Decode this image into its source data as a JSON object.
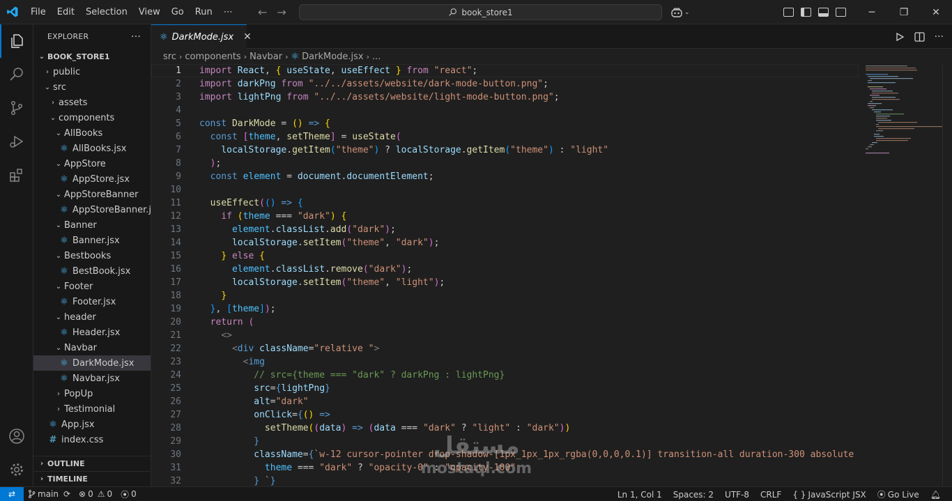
{
  "menu": [
    "File",
    "Edit",
    "Selection",
    "View",
    "Go",
    "Run",
    "⋯"
  ],
  "search": {
    "text": "book_store1"
  },
  "explorer": {
    "title": "EXPLORER",
    "more": "···",
    "root": "BOOK_STORE1",
    "tree": [
      {
        "label": "public",
        "type": "folder",
        "open": false,
        "depth": 0
      },
      {
        "label": "src",
        "type": "folder",
        "open": true,
        "depth": 0
      },
      {
        "label": "assets",
        "type": "folder",
        "open": false,
        "depth": 1
      },
      {
        "label": "components",
        "type": "folder",
        "open": true,
        "depth": 1
      },
      {
        "label": "AllBooks",
        "type": "folder",
        "open": true,
        "depth": 2
      },
      {
        "label": "AllBooks.jsx",
        "type": "jsx",
        "depth": 3
      },
      {
        "label": "AppStore",
        "type": "folder",
        "open": true,
        "depth": 2
      },
      {
        "label": "AppStore.jsx",
        "type": "jsx",
        "depth": 3
      },
      {
        "label": "AppStoreBanner",
        "type": "folder",
        "open": true,
        "depth": 2
      },
      {
        "label": "AppStoreBanner.j...",
        "type": "jsx",
        "depth": 3
      },
      {
        "label": "Banner",
        "type": "folder",
        "open": true,
        "depth": 2
      },
      {
        "label": "Banner.jsx",
        "type": "jsx",
        "depth": 3
      },
      {
        "label": "Bestbooks",
        "type": "folder",
        "open": true,
        "depth": 2
      },
      {
        "label": "BestBook.jsx",
        "type": "jsx",
        "depth": 3
      },
      {
        "label": "Footer",
        "type": "folder",
        "open": true,
        "depth": 2
      },
      {
        "label": "Footer.jsx",
        "type": "jsx",
        "depth": 3
      },
      {
        "label": "header",
        "type": "folder",
        "open": true,
        "depth": 2
      },
      {
        "label": "Header.jsx",
        "type": "jsx",
        "depth": 3
      },
      {
        "label": "Navbar",
        "type": "folder",
        "open": true,
        "depth": 2
      },
      {
        "label": "DarkMode.jsx",
        "type": "jsx",
        "depth": 3,
        "selected": true
      },
      {
        "label": "Navbar.jsx",
        "type": "jsx",
        "depth": 3
      },
      {
        "label": "PopUp",
        "type": "folder",
        "open": false,
        "depth": 2
      },
      {
        "label": "Testimonial",
        "type": "folder",
        "open": false,
        "depth": 2
      },
      {
        "label": "App.jsx",
        "type": "jsx",
        "depth": 1
      },
      {
        "label": "index.css",
        "type": "css",
        "depth": 1
      }
    ],
    "outline": "OUTLINE",
    "timeline": "TIMELINE"
  },
  "tab": {
    "label": "DarkMode.jsx",
    "close": "✕"
  },
  "breadcrumb": {
    "parts": [
      "src",
      "components",
      "Navbar",
      "DarkMode.jsx",
      "..."
    ]
  },
  "code": {
    "current_line": 1,
    "line_numbers": [
      "1",
      "2",
      "3",
      "4",
      "5",
      "6",
      "7",
      "8",
      "9",
      "10",
      "11",
      "12",
      "13",
      "14",
      "15",
      "16",
      "17",
      "18",
      "19",
      "20",
      "21",
      "22",
      "23",
      "24",
      "25",
      "26",
      "27",
      "28",
      "29",
      "30",
      "31",
      "32"
    ]
  },
  "watermark": {
    "arabic": "مستقل",
    "latin": "mostaql.com"
  },
  "status": {
    "branch": "main",
    "errors": "0",
    "warnings": "0",
    "ports": "0",
    "position": "Ln 1, Col 1",
    "spaces": "Spaces: 2",
    "encoding": "UTF-8",
    "eol": "CRLF",
    "language": "JavaScript JSX",
    "golive": "Go Live"
  },
  "colors": {
    "accent": "#0078d4",
    "react": "#4fc1ff"
  }
}
